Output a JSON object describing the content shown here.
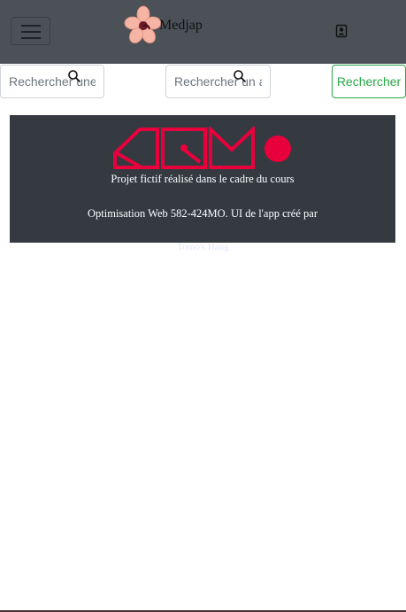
{
  "navbar": {
    "brand_text": "Medjap",
    "brand_logo_icon": "flower-logo-icon",
    "menu_icon": "hamburger-icon",
    "user_icon": "user-icon"
  },
  "search": {
    "field1_placeholder": "Rechercher une c",
    "field2_placeholder": "Rechercher un ar",
    "search_icon": "search-icon",
    "button_label": "Rechercher"
  },
  "footer": {
    "line1": "Projet fictif réalisé dans le cadre du cours",
    "line2": "Optimisation Web 582-424MO. UI de l'app créé par",
    "credit_link": "Tomo's Hang",
    "logo_icon": "aqm-logo-icon"
  },
  "colors": {
    "navbar_bg": "#4b5157",
    "footer_bg": "#343a40",
    "accent_green": "#28a745",
    "logo_red": "#e8003d",
    "flower_pink": "#f5b4a4"
  }
}
